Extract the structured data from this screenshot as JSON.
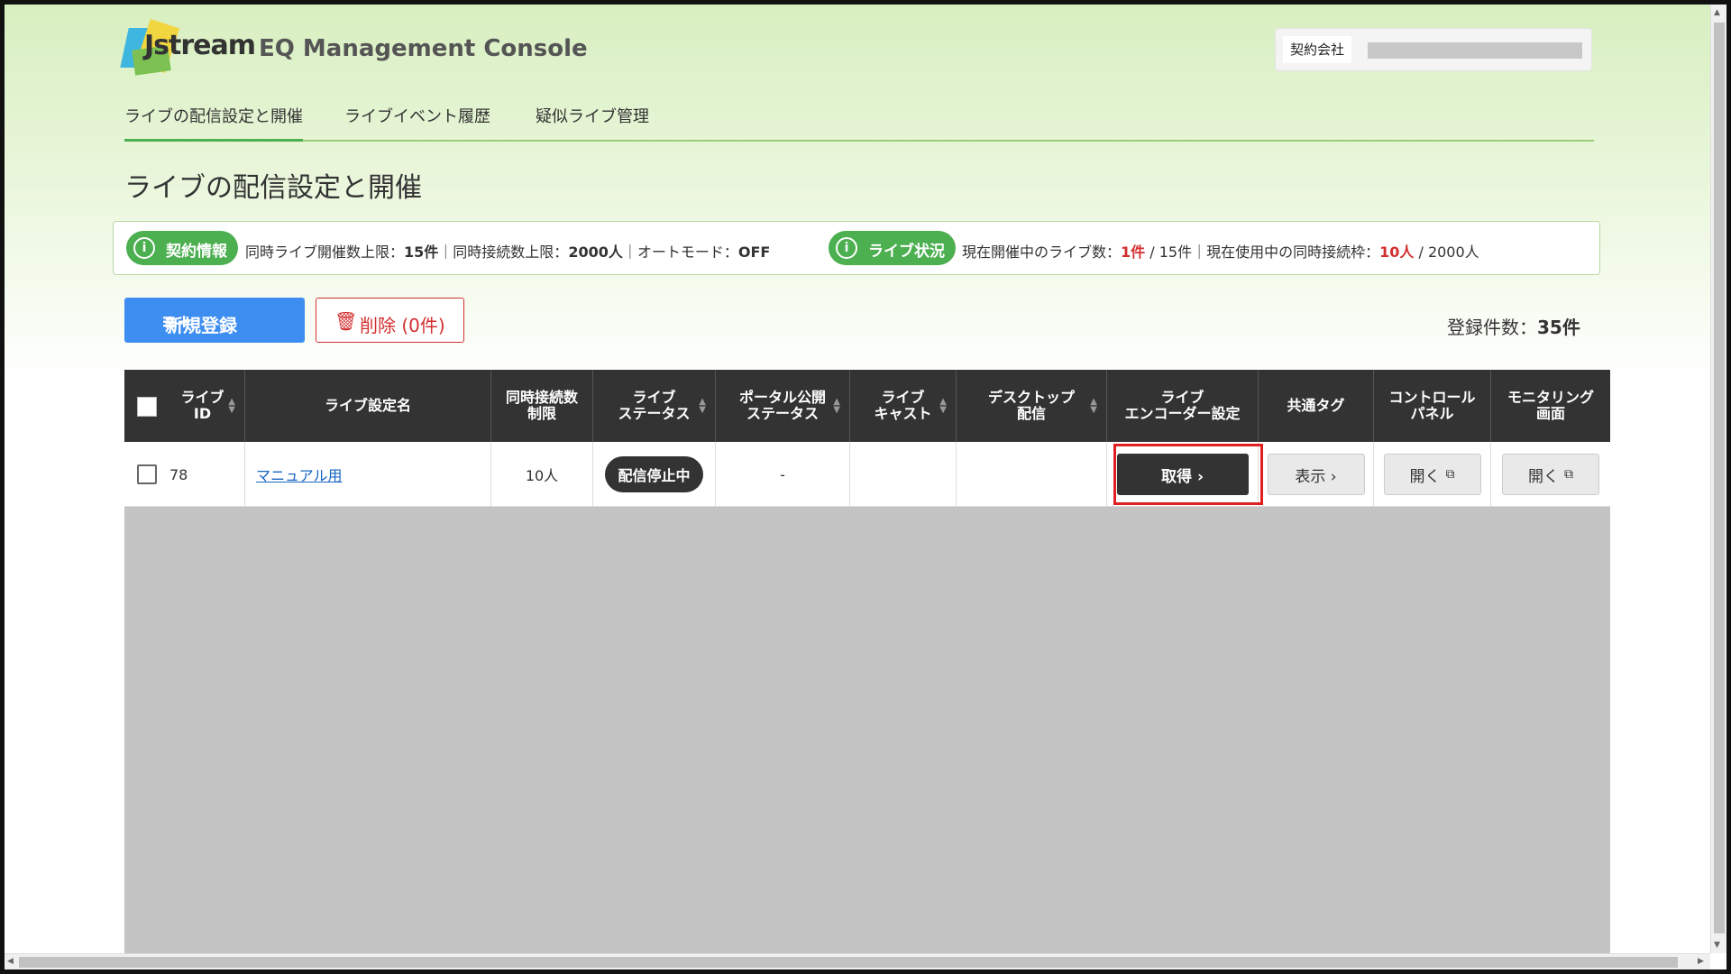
{
  "header": {
    "logo_text": "Jstream",
    "app_title": "EQ Management Console",
    "company_label": "契約会社"
  },
  "nav": {
    "items": [
      {
        "label": "ライブの配信設定と開催",
        "active": true
      },
      {
        "label": "ライブイベント履歴",
        "active": false
      },
      {
        "label": "疑似ライブ管理",
        "active": false
      }
    ]
  },
  "page_title": "ライブの配信設定と開催",
  "info": {
    "contract_label": "契約情報",
    "contract_text_1": "同時ライブ開催数上限：",
    "contract_val_1": "15件",
    "contract_text_2": "｜同時接続数上限：",
    "contract_val_2": "2000人",
    "contract_text_3": "｜オートモード：",
    "contract_val_3": "OFF",
    "live_label": "ライブ状況",
    "live_text_1": "現在開催中のライブ数：",
    "live_val_1": "1件",
    "live_text_2": " / 15件｜現在使用中の同時接続枠：",
    "live_val_2": "10人",
    "live_text_3": " / 2000人"
  },
  "actions": {
    "new_label": "新規登録",
    "delete_label": "削除 (0件)",
    "count_prefix": "登録件数：",
    "count_value": "35件"
  },
  "table": {
    "headers": {
      "live_id": [
        "ライブ",
        "ID"
      ],
      "name": "ライブ設定名",
      "limit": [
        "同時接続数",
        "制限"
      ],
      "status": [
        "ライブ",
        "ステータス"
      ],
      "portal": [
        "ポータル公開",
        "ステータス"
      ],
      "cast": [
        "ライブ",
        "キャスト"
      ],
      "desktop": [
        "デスクトップ",
        "配信"
      ],
      "encoder": [
        "ライブ",
        "エンコーダー設定"
      ],
      "tag": "共通タグ",
      "control": [
        "コントロール",
        "パネル"
      ],
      "monitor": [
        "モニタリング",
        "画面"
      ]
    },
    "rows": [
      {
        "id": "78",
        "name": "マニュアル用",
        "limit": "10人",
        "status": "配信停止中",
        "portal": "-",
        "cast": "",
        "desktop": "",
        "encoder_btn": "取得 ›",
        "tag_btn": "表示 ›",
        "control_btn": "開く",
        "monitor_btn": "開く"
      }
    ]
  },
  "colors": {
    "accent_green": "#4caf50",
    "primary_blue": "#3e8ef2",
    "danger_red": "#d32f2f",
    "table_header": "#333333"
  }
}
